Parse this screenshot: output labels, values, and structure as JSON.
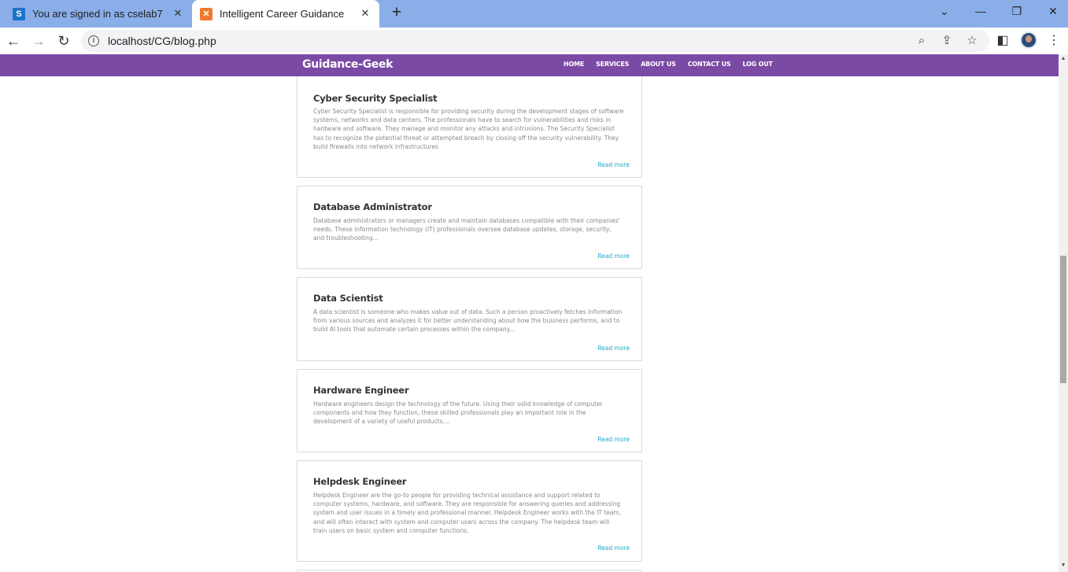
{
  "browser": {
    "tabs": [
      {
        "title": "You are signed in as cselab7",
        "icon": "s-favicon",
        "active": false
      },
      {
        "title": "Intelligent Career Guidance",
        "icon": "xampp-favicon",
        "active": true
      }
    ],
    "url": "localhost/CG/blog.php"
  },
  "site": {
    "brand": "Guidance-Geek",
    "nav": [
      "HOME",
      "SERVICES",
      "ABOUT US",
      "CONTACT US",
      "LOG OUT"
    ],
    "accent": "#7b4aa5",
    "link_color": "#23a8c6"
  },
  "cards": [
    {
      "title": "Cyber Security Specialist",
      "body": "Cyber Security Specialist is responsible for providing security during the development stages of software systems, networks and data centers. The professionals have to search for vulnerabilities and risks in hardware and software. They manage and monitor any attacks and intrusions. The Security Specialist has to recognize the potential threat or attempted breach by closing off the security vulnerability. They build firewalls into network infrastructures",
      "link": "Read more"
    },
    {
      "title": "Database Administrator",
      "body": "Database administrators or managers create and maintain databases compatible with their companies' needs. These information technology (IT) professionals oversee database updates, storage, security, and troubleshooting...",
      "link": "Read more"
    },
    {
      "title": "Data Scientist",
      "body": "A data scientist is someone who makes value out of data. Such a person proactively fetches information from various sources and analyzes it for better understanding about how the business performs, and to build AI tools that automate certain processes within the company...",
      "link": "Read more"
    },
    {
      "title": "Hardware Engineer",
      "body": "Hardware engineers design the technology of the future. Using their solid knowledge of computer components and how they function, these skilled professionals play an important role in the development of a variety of useful products....",
      "link": "Read more"
    },
    {
      "title": "Helpdesk Engineer",
      "body": "Helpdesk Engineer are the go-to people for providing technical assistance and support related to computer systems, hardware, and software. They are responsible for answering queries and addressing system and user issues in a timely and professional manner. Helpdesk Engineer works with the IT team, and will often interact with system and computer users across the company. The helpdesk team will train users on basic system and computer functions.",
      "link": "Read more"
    }
  ]
}
